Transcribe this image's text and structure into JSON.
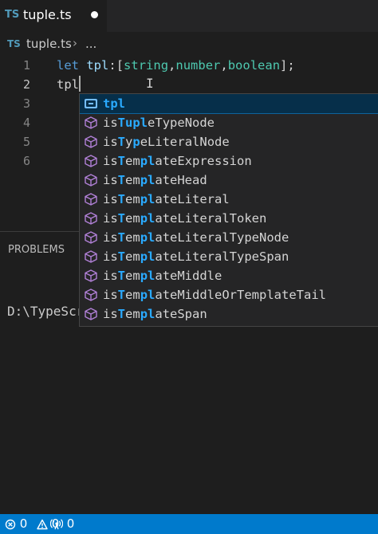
{
  "tab": {
    "badge": "TS",
    "title": "tuple.ts"
  },
  "breadcrumb": {
    "badge": "TS",
    "file": "tuple.ts",
    "separator": "›",
    "more": "..."
  },
  "editor": {
    "line_numbers": [
      "1",
      "2",
      "3",
      "4",
      "5",
      "6"
    ],
    "line1": {
      "keyword": "let",
      "var": "tpl",
      "colon": ":",
      "open": "[",
      "t1": "string",
      "c1": ",",
      "t2": "number",
      "c2": ",",
      "t3": "boolean",
      "close": "];"
    },
    "line2": {
      "typed": "tpl"
    },
    "ibeam": "I"
  },
  "suggestions": [
    {
      "icon": "variable",
      "pre": "",
      "m1": "tpl",
      "mid": "",
      "m2": "",
      "post": "",
      "selected": true
    },
    {
      "icon": "method",
      "pre": "is",
      "m1": "T",
      "mid": "u",
      "m2": "pl",
      "post": "eTypeNode"
    },
    {
      "icon": "method",
      "pre": "is",
      "m1": "T",
      "mid": "y",
      "m2": "p",
      "post": "eLiteralNode",
      "m2b": "L",
      "post2": "iteralNode"
    },
    {
      "icon": "method",
      "pre": "is",
      "m1": "T",
      "mid": "em",
      "m2": "pl",
      "post": "ateExpression"
    },
    {
      "icon": "method",
      "pre": "is",
      "m1": "T",
      "mid": "em",
      "m2": "pl",
      "post": "ateHead"
    },
    {
      "icon": "method",
      "pre": "is",
      "m1": "T",
      "mid": "em",
      "m2": "pl",
      "post": "ateLiteral"
    },
    {
      "icon": "method",
      "pre": "is",
      "m1": "T",
      "mid": "em",
      "m2": "pl",
      "post": "ateLiteralToken"
    },
    {
      "icon": "method",
      "pre": "is",
      "m1": "T",
      "mid": "em",
      "m2": "pl",
      "post": "ateLiteralTypeNode"
    },
    {
      "icon": "method",
      "pre": "is",
      "m1": "T",
      "mid": "em",
      "m2": "pl",
      "post": "ateLiteralTypeSpan"
    },
    {
      "icon": "method",
      "pre": "is",
      "m1": "T",
      "mid": "em",
      "m2": "pl",
      "post": "ateMiddle"
    },
    {
      "icon": "method",
      "pre": "is",
      "m1": "T",
      "mid": "em",
      "m2": "pl",
      "post": "ateMiddleOrTemplateTail"
    },
    {
      "icon": "method",
      "pre": "is",
      "m1": "T",
      "mid": "em",
      "m2": "pl",
      "post": "ateSpan"
    }
  ],
  "panel": {
    "problems_label": "PROBLEMS",
    "terminal_text": "D:\\TypeScr"
  },
  "status": {
    "errors": "0",
    "warnings": "0",
    "ports": "0"
  },
  "colors": {
    "statusbar": "#007acc",
    "highlight": "#2aaaff",
    "method_icon": "#b180d7",
    "variable_icon": "#75beff"
  }
}
